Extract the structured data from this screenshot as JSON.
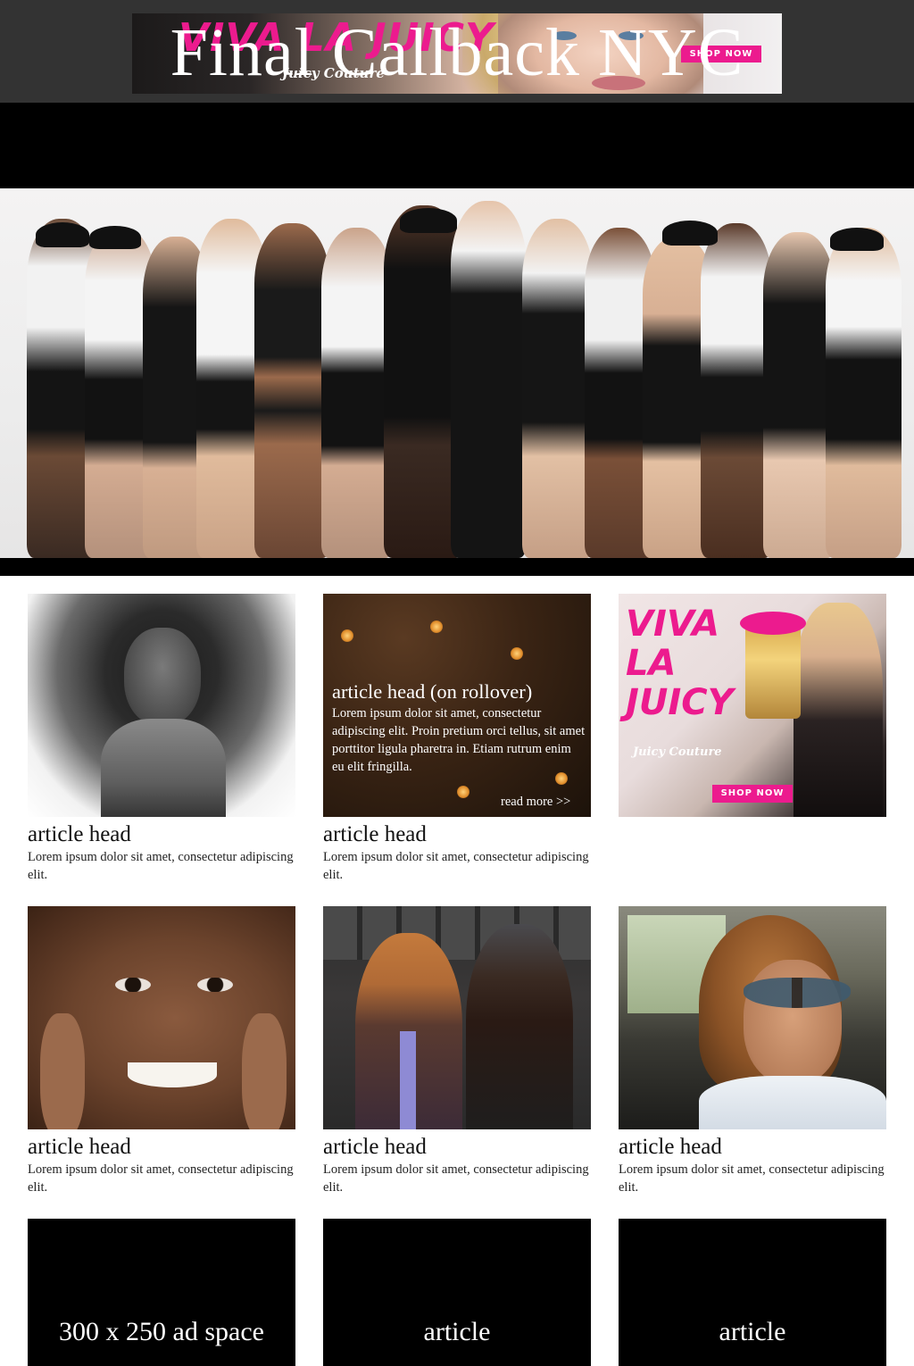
{
  "leaderboard_ad": {
    "headline": "VIVA LA JUICY",
    "brand": "Juicy Couture",
    "cta": "SHOP NOW"
  },
  "site": {
    "title": "Final Callback NYC"
  },
  "articles": [
    {
      "head": "article head",
      "text": "Lorem ipsum dolor sit amet, consectetur adipiscing elit."
    },
    {
      "head": "article head",
      "text": "Lorem ipsum dolor sit amet, consectetur adipiscing elit.",
      "overlay": {
        "head": "article head (on rollover)",
        "text": "Lorem ipsum dolor sit amet, consectetur adipiscing elit. Proin pretium orci tellus, sit amet porttitor ligula pharetra in. Etiam rutrum enim eu elit fringilla.",
        "read_more": "read more >>"
      }
    },
    {
      "head": "article head",
      "text": "Lorem ipsum dolor sit amet, consectetur adipiscing elit."
    },
    {
      "head": "article head",
      "text": "Lorem ipsum dolor sit amet, consectetur adipiscing elit."
    },
    {
      "head": "article head",
      "text": "Lorem ipsum dolor sit amet, consectetur adipiscing elit."
    }
  ],
  "side_ad": {
    "headline": "VIVA LA JUICY",
    "brand": "Juicy Couture",
    "cta": "SHOP NOW"
  },
  "placeholders": [
    {
      "label": "300 x 250 ad space"
    },
    {
      "label": "article"
    },
    {
      "label": "article"
    }
  ],
  "colors": {
    "top_band": "#333333",
    "masthead": "#000000",
    "brand_pink": "#ec1b8e"
  }
}
